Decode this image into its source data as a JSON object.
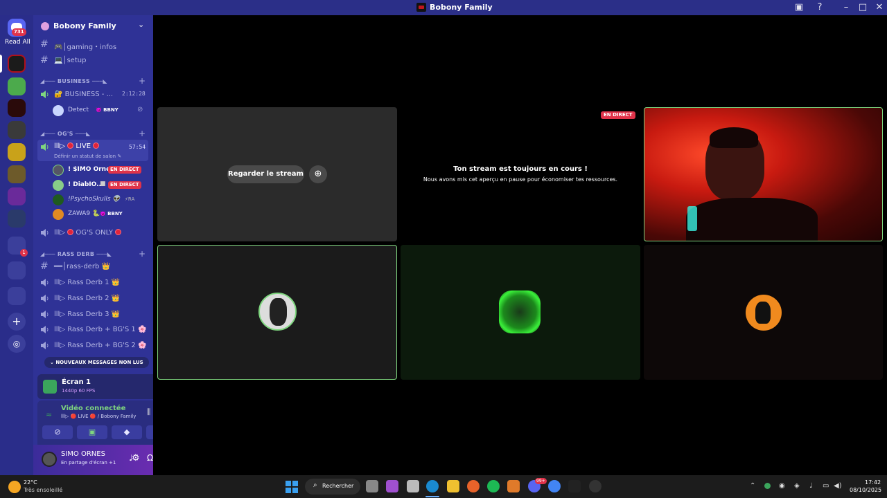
{
  "window": {
    "title": "Bobony Family"
  },
  "rail": {
    "badge": "731",
    "read_all": "Read All",
    "badge2": "1"
  },
  "guild": {
    "name": "Bobony Family"
  },
  "channels": {
    "gaming": "🎮│gaming・infos",
    "setup": "💻│setup",
    "cat_business": "◢─── BUSINESS ───◣",
    "business_voice": "🔐 BUSINESS - ...",
    "business_timer": "2:12:28",
    "detect_user": "Detect",
    "detect_tag": "👿 BBNY",
    "cat_ogs": "◢─── OG'S ───◣",
    "live_channel": "lll▷",
    "live_word": "LIVE",
    "live_timer": "57:54",
    "status_hint": "Définir un statut de salon ✎",
    "u1": "! $IMO Orne...",
    "u2": "! DiabIO...",
    "u3": "!PsychoSkulls 👽",
    "u3_tag": "⚡RA",
    "u4": "ZAWA9 🐍",
    "u4_tag": "👿 BBNY",
    "live_badge": "EN DIRECT",
    "ogs_only": "OG'S ONLY",
    "ogs_prefix": "lll▷",
    "cat_rass": "◢─── RASS DERB ───◣",
    "rass_text": "══│rass-derb 👑",
    "rass1": "lll▷ Rass Derb 1 👑",
    "rass2": "lll▷ Rass Derb 2 👑",
    "rass3": "lll▷ Rass Derb 3 👑",
    "rass_bg1": "lll▷ Rass Derb + BG'S 1 🌸",
    "rass_bg2": "lll▷ Rass Derb + BG'S 2 🌸",
    "new_msgs": "NOUVEAUX MESSAGES NON LUS"
  },
  "screen": {
    "title": "Écran 1",
    "quality": "1440p 60 FPS"
  },
  "voice": {
    "status": "Vidéo connectée",
    "path": "lll▷ 🔴 LIVE 🔴 / Bobony Family"
  },
  "user": {
    "name": "SIMO ORNES",
    "status": "En partage d'écran +1"
  },
  "stage": {
    "watch_btn": "Regarder le stream",
    "paused_title": "Ton stream est toujours en cours !",
    "paused_body": "Nous avons mis cet aperçu en pause pour économiser tes ressources.",
    "live_badge": "EN DIRECT"
  },
  "taskbar": {
    "temp": "22°C",
    "weather": "Très ensoleillé",
    "search": "Rechercher",
    "time": "17:42",
    "date": "08/10/2025",
    "notif": "99+"
  },
  "colors": {
    "accent": "#2f3296",
    "live_red": "#e0334a",
    "speaking_green": "#7fd67f"
  }
}
